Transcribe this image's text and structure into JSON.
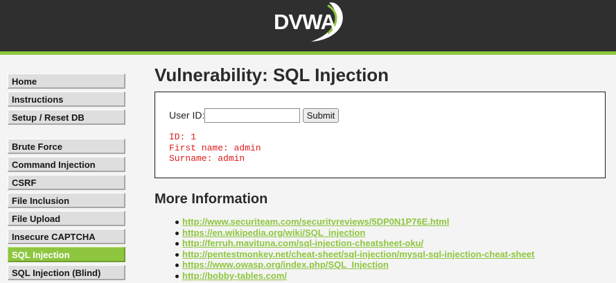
{
  "header": {
    "logo_text": "DVWA",
    "colors": {
      "background": "#2f2f2f",
      "accent": "#8ec63f"
    }
  },
  "sidebar": {
    "top_items": [
      {
        "label": "Home"
      },
      {
        "label": "Instructions"
      },
      {
        "label": "Setup / Reset DB"
      }
    ],
    "vuln_items": [
      {
        "label": "Brute Force"
      },
      {
        "label": "Command Injection"
      },
      {
        "label": "CSRF"
      },
      {
        "label": "File Inclusion"
      },
      {
        "label": "File Upload"
      },
      {
        "label": "Insecure CAPTCHA"
      },
      {
        "label": "SQL Injection",
        "selected": true
      },
      {
        "label": "SQL Injection (Blind)"
      }
    ]
  },
  "main": {
    "title": "Vulnerability: SQL Injection",
    "form": {
      "user_id_label": "User ID:",
      "user_id_value": "",
      "submit_label": "Submit"
    },
    "result": {
      "id_line": "ID: 1",
      "first_name_line": "First name: admin",
      "surname_line": "Surname: admin"
    },
    "more_info": {
      "heading": "More Information",
      "links": [
        "http://www.securiteam.com/securityreviews/5DP0N1P76E.html",
        "https://en.wikipedia.org/wiki/SQL_injection",
        "http://ferruh.mavituna.com/sql-injection-cheatsheet-oku/",
        "http://pentestmonkey.net/cheat-sheet/sql-injection/mysql-sql-injection-cheat-sheet",
        "https://www.owasp.org/index.php/SQL_Injection",
        "http://bobby-tables.com/"
      ]
    }
  }
}
